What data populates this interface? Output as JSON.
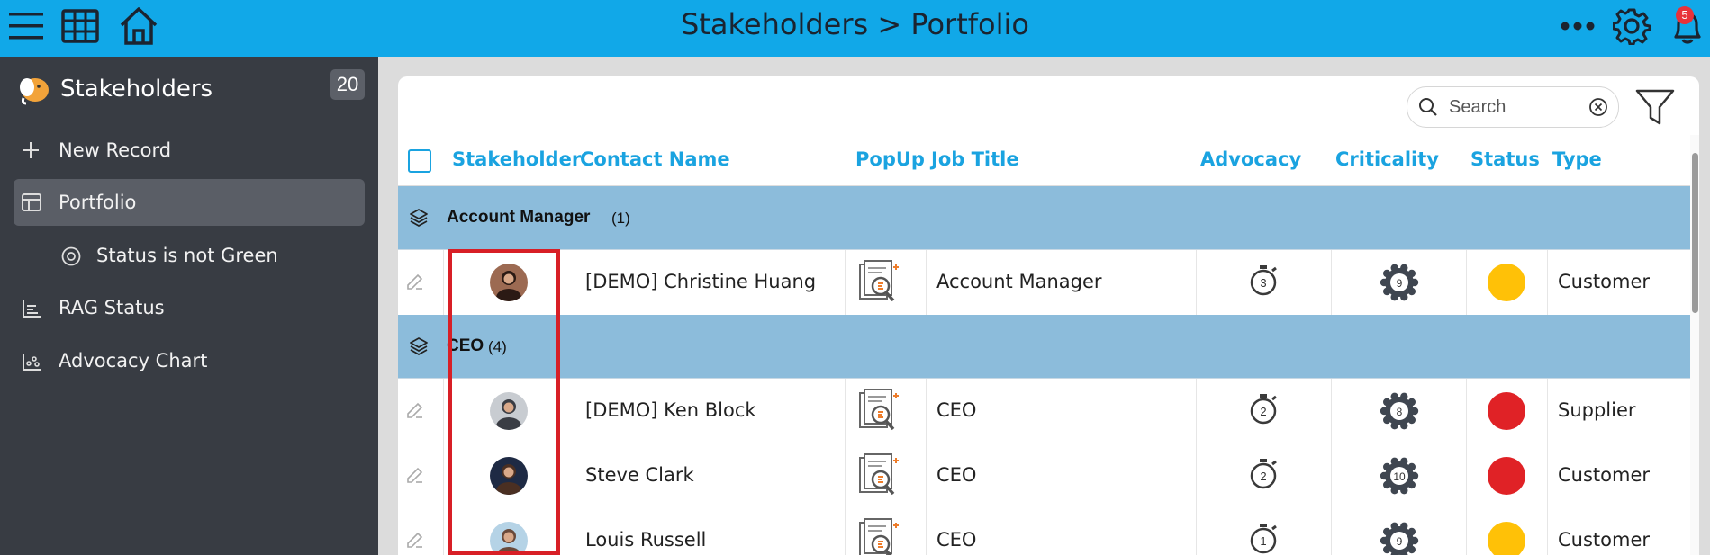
{
  "header": {
    "title": "Stakeholders > Portfolio",
    "notification_count": "5",
    "icons": [
      "menu-icon",
      "grid-icon",
      "home-icon",
      "more-icon",
      "gear-icon",
      "bell-icon"
    ]
  },
  "sidebar": {
    "app_name": "Stakeholders",
    "record_count": "20",
    "items": [
      {
        "label": "New Record",
        "icon": "plus-icon"
      },
      {
        "label": "Portfolio",
        "icon": "table-icon",
        "active": true
      },
      {
        "label": "Status is not Green",
        "icon": "filter-view-icon",
        "sub": true
      },
      {
        "label": "RAG Status",
        "icon": "bar-chart-icon"
      },
      {
        "label": "Advocacy Chart",
        "icon": "scatter-chart-icon"
      }
    ]
  },
  "toolbar": {
    "search_placeholder": "Search"
  },
  "table": {
    "columns": [
      "Stakeholder",
      "Contact Name",
      "PopUp",
      "Job Title",
      "Advocacy",
      "Criticality",
      "Status",
      "Type"
    ],
    "groups": [
      {
        "name": "Account Manager",
        "count": "(1)",
        "rows": [
          {
            "contact": "[DEMO] Christine Huang",
            "job": "Account Manager",
            "advocacy": "3",
            "criticality": "9",
            "status_color": "#ffc107",
            "type": "Customer",
            "avatar_bg": "#9c6a52",
            "avatar_fg": "#2b1a14"
          }
        ]
      },
      {
        "name": "CEO",
        "count": "(4)",
        "rows": [
          {
            "contact": "[DEMO] Ken Block",
            "job": "CEO",
            "advocacy": "2",
            "criticality": "8",
            "status_color": "#e02226",
            "type": "Supplier",
            "avatar_bg": "#c8ccd1",
            "avatar_fg": "#3a3d44"
          },
          {
            "contact": "Steve Clark",
            "job": "CEO",
            "advocacy": "2",
            "criticality": "10",
            "status_color": "#e02226",
            "type": "Customer",
            "avatar_bg": "#1e2a44",
            "avatar_fg": "#4a2f22"
          },
          {
            "contact": "Louis Russell",
            "job": "CEO",
            "advocacy": "1",
            "criticality": "9",
            "status_color": "#ffc107",
            "type": "Customer",
            "avatar_bg": "#b5d3e6",
            "avatar_fg": "#6a4a3a"
          }
        ]
      }
    ]
  },
  "colors": {
    "brand": "#11a8e8",
    "sidebar": "#383c43",
    "group_row": "#8cbcdb",
    "accent_text": "#1aa3e0",
    "highlight": "#d81f26"
  }
}
